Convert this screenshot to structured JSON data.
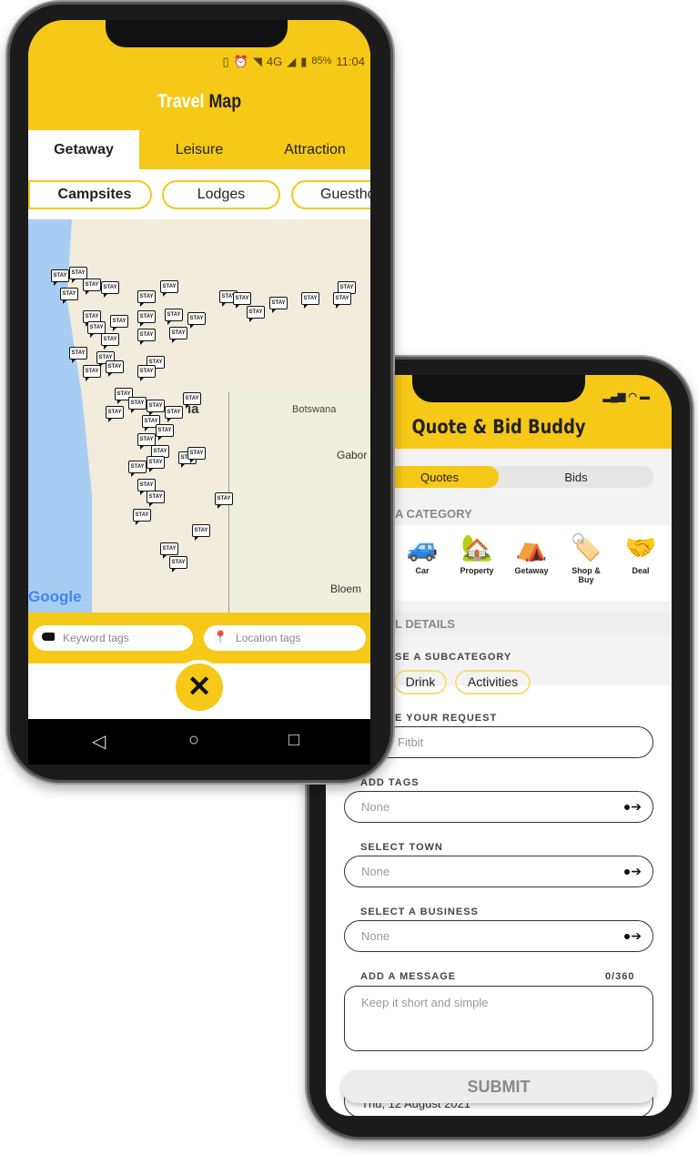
{
  "travel_map": {
    "status": {
      "network": "4G",
      "battery": "85%",
      "time": "11:04"
    },
    "title_part1": "Travel",
    "title_part2": "Map",
    "tabs": [
      {
        "label": "Getaway",
        "active": true
      },
      {
        "label": "Leisure"
      },
      {
        "label": "Attraction"
      }
    ],
    "chips": [
      {
        "label": "Campsites",
        "active": true
      },
      {
        "label": "Lodges"
      },
      {
        "label": "Guestho"
      }
    ],
    "map": {
      "marker_label": "STAY",
      "labels": [
        "ia",
        "Botswana",
        "Gabor",
        "Bloem"
      ],
      "logo": "Google"
    },
    "search": {
      "keyword_placeholder": "Keyword tags",
      "location_placeholder": "Location tags"
    },
    "close_icon": "close-icon",
    "accent": "#f6c817"
  },
  "quote_bid": {
    "title": "Quote & Bid Buddy",
    "segments": [
      {
        "label": "Quotes",
        "active": true
      },
      {
        "label": "Bids"
      }
    ],
    "category_heading": "A CATEGORY",
    "categories": [
      {
        "label": "Car",
        "icon": "🚙"
      },
      {
        "label": "Property",
        "icon": "🏡"
      },
      {
        "label": "Getaway",
        "icon": "⛺"
      },
      {
        "label": "Shop & Buy",
        "icon": "🏷️"
      },
      {
        "label": "Deal",
        "icon": "🤝"
      }
    ],
    "details_heading": "L DETAILS",
    "subcategory_label": "SE A SUBCATEGORY",
    "subcategories": [
      "Drink",
      "Activities"
    ],
    "request_label": "E YOUR REQUEST",
    "request_value": "Fitbit",
    "tags_label": "ADD TAGS",
    "tags_value": "None",
    "town_label": "SELECT TOWN",
    "town_value": "None",
    "business_label": "SELECT A BUSINESS",
    "business_value": "None",
    "message_label": "ADD A MESSAGE",
    "message_count": "0/360",
    "message_placeholder": "Keep it short and simple",
    "date_value": "Thu, 12 August 2021",
    "submit_label": "SUBMIT"
  }
}
